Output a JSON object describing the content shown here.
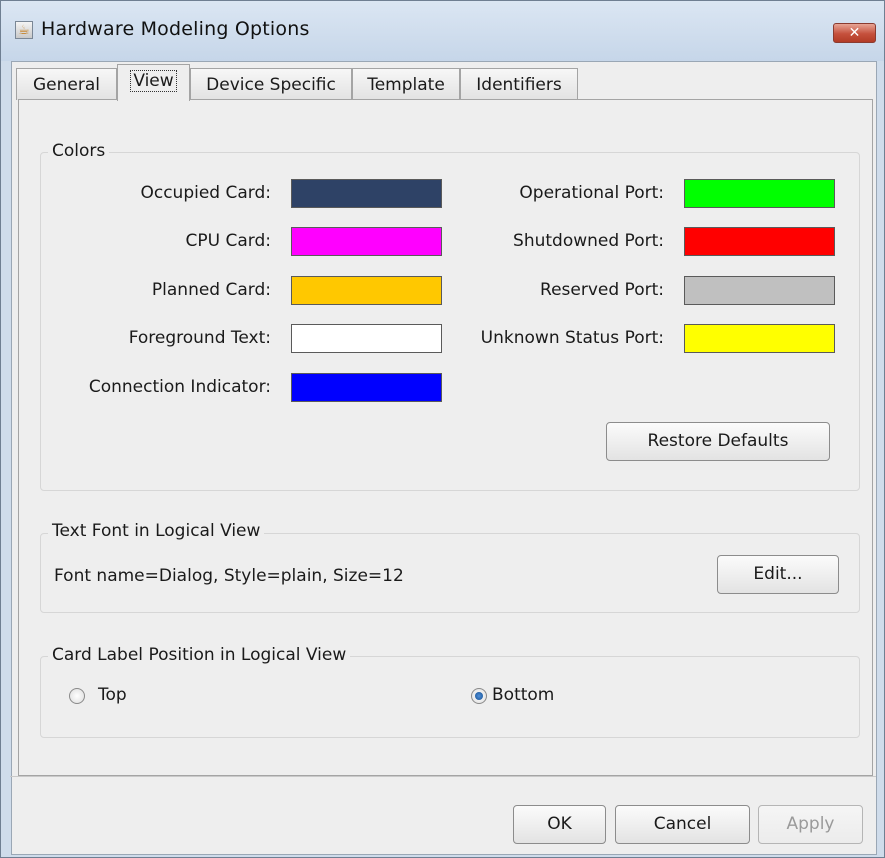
{
  "window": {
    "title": "Hardware Modeling Options",
    "close_glyph": "✕",
    "app_icon": "java-cup-icon"
  },
  "tabs": [
    {
      "label": "General"
    },
    {
      "label": "View"
    },
    {
      "label": "Device Specific"
    },
    {
      "label": "Template"
    },
    {
      "label": "Identifiers"
    }
  ],
  "active_tab": "View",
  "colors": {
    "title": "Colors",
    "items": [
      {
        "label": "Occupied Card:",
        "color": "#2e4266"
      },
      {
        "label": "CPU Card:",
        "color": "#ff00ff"
      },
      {
        "label": "Planned Card:",
        "color": "#ffc800"
      },
      {
        "label": "Foreground Text:",
        "color": "#ffffff"
      },
      {
        "label": "Connection Indicator:",
        "color": "#0000ff"
      },
      {
        "label": "Operational Port:",
        "color": "#00ff00"
      },
      {
        "label": "Shutdowned Port:",
        "color": "#ff0000"
      },
      {
        "label": "Reserved Port:",
        "color": "#c0c0c0"
      },
      {
        "label": "Unknown Status Port:",
        "color": "#ffff00"
      }
    ],
    "restore_label": "Restore Defaults"
  },
  "font": {
    "title": "Text Font in Logical View",
    "value": "Font name=Dialog, Style=plain, Size=12",
    "edit_label": "Edit..."
  },
  "label_position": {
    "title": "Card Label Position in Logical View",
    "options": [
      {
        "label": "Top",
        "checked": false
      },
      {
        "label": "Bottom",
        "checked": true
      }
    ]
  },
  "footer": {
    "ok_label": "OK",
    "cancel_label": "Cancel",
    "apply_label": "Apply"
  }
}
